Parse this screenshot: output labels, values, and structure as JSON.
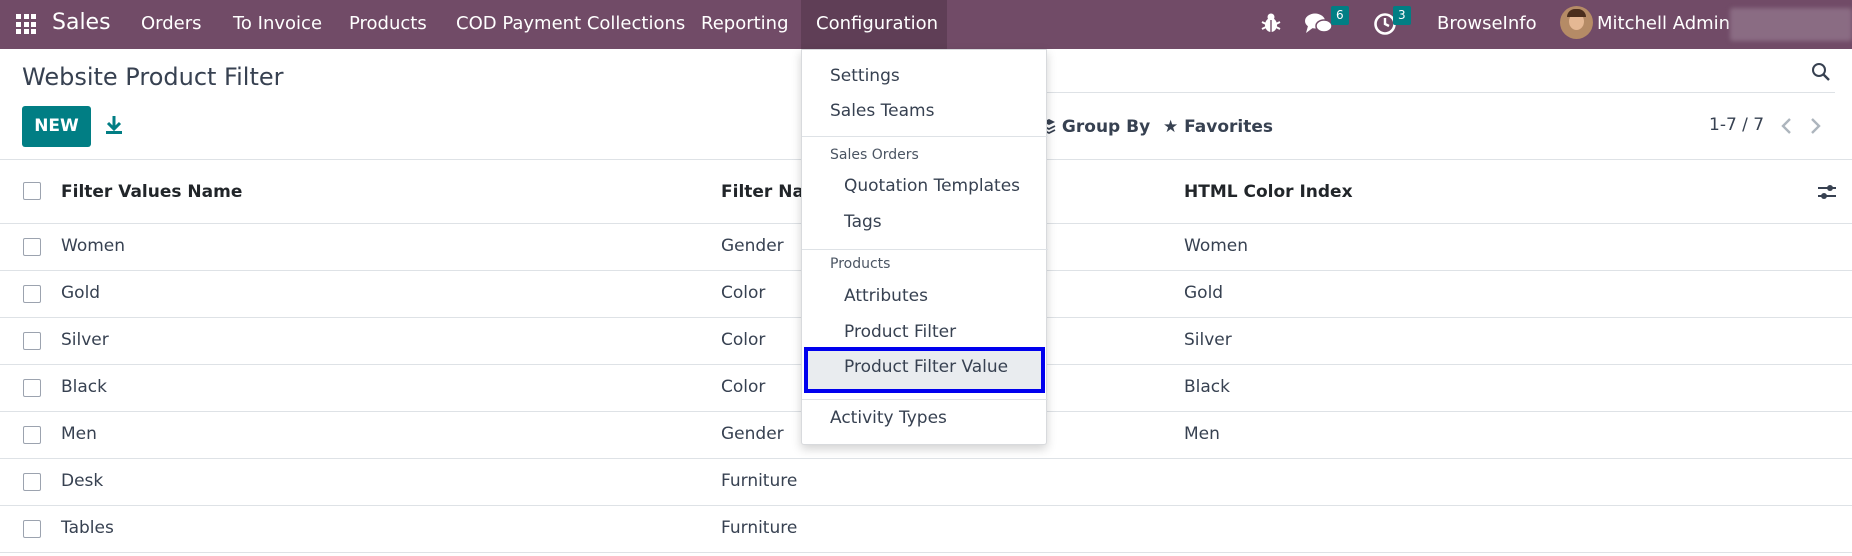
{
  "navbar": {
    "brand": "Sales",
    "menu": [
      "Orders",
      "To Invoice",
      "Products",
      "COD Payment Collections",
      "Reporting",
      "Configuration"
    ],
    "messages_badge": "6",
    "activities_badge": "3",
    "company": "BrowseInfo",
    "user": "Mitchell Admin ("
  },
  "control_panel": {
    "title": "Website Product Filter",
    "new_label": "NEW",
    "group_by_label": "Group By",
    "favorites_label": "Favorites",
    "pager": "1-7 / 7"
  },
  "list": {
    "columns": [
      "Filter Values Name",
      "Filter Name",
      "HTML Color Index"
    ],
    "rows": [
      {
        "name": "Women",
        "filter": "Gender",
        "color": "Women"
      },
      {
        "name": "Gold",
        "filter": "Color",
        "color": "Gold"
      },
      {
        "name": "Silver",
        "filter": "Color",
        "color": "Silver"
      },
      {
        "name": "Black",
        "filter": "Color",
        "color": "Black"
      },
      {
        "name": "Men",
        "filter": "Gender",
        "color": "Men"
      },
      {
        "name": "Desk",
        "filter": "Furniture",
        "color": ""
      },
      {
        "name": "Tables",
        "filter": "Furniture",
        "color": ""
      }
    ]
  },
  "config_menu": {
    "settings": "Settings",
    "sales_teams": "Sales Teams",
    "sales_orders_header": "Sales Orders",
    "quotation_templates": "Quotation Templates",
    "tags": "Tags",
    "products_header": "Products",
    "attributes": "Attributes",
    "product_filter": "Product Filter",
    "product_filter_value": "Product Filter Value",
    "activity_types": "Activity Types"
  },
  "colors": {
    "navbar": "#714b67",
    "primary": "#017e84",
    "highlight_border": "#0000ee"
  }
}
